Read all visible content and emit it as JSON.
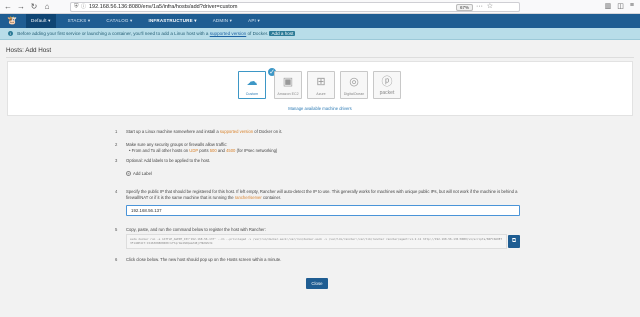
{
  "browser": {
    "url": "192.168.56.136:8080/env/1a5/infra/hosts/add?driver=custom",
    "zoom": "67%",
    "back_glyph": "←",
    "forward_glyph": "→",
    "reload_glyph": "↻",
    "home_glyph": "⌂",
    "shield_glyph": "⛨",
    "lock_glyph": "ⓘ",
    "dots_glyph": "···",
    "star_glyph": "☆",
    "library_glyph": "▥",
    "sidebar_glyph": "◫",
    "menu_glyph": "≡"
  },
  "header": {
    "logo_glyph": "🐮",
    "env_label": "Default ▾",
    "menu": [
      "STACKS ▾",
      "CATALOG ▾",
      "INFRASTRUCTURE ▾",
      "ADMIN ▾",
      "API ▾"
    ],
    "active_index": 2
  },
  "notice": {
    "info_glyph": "i",
    "text_before": "Before adding your first service or launching a container, you'll need to add a Linux host with a",
    "link_text": "supported version",
    "text_after": "of Docker.",
    "hide_label": "Add a host"
  },
  "page": {
    "title": "Hosts: Add Host"
  },
  "drivers": {
    "items": [
      {
        "label": "Custom",
        "glyph": "☁",
        "selected": true
      },
      {
        "label": "Amazon EC2",
        "glyph": "▣",
        "selected": false
      },
      {
        "label": "Azure",
        "glyph": "⊞",
        "selected": false
      },
      {
        "label": "DigitalOcean",
        "glyph": "◎",
        "selected": false
      },
      {
        "label": "packet",
        "glyph": "ⓟ",
        "selected": false
      }
    ],
    "check_glyph": "✓",
    "manage_link": "Manage available machine drivers"
  },
  "steps": {
    "s1_num": "1",
    "s1_a": "Start up a Linux machine somewhere and install a",
    "s1_link": "supported version",
    "s1_b": "of Docker on it.",
    "s2_num": "2",
    "s2_line1": "Make sure any security groups or firewalls allow traffic:",
    "s2_line2_a": "• From and To all other hosts on",
    "s2_udp1": "UDP",
    "s2_line2_b": "ports",
    "s2_p1": "500",
    "s2_line2_c": "and",
    "s2_p2": "4500",
    "s2_line2_d": "(for IPsec networking)",
    "s3_num": "3",
    "s3_text": "Optional: Add labels to be applied to the host.",
    "add_label_glyph": "+",
    "add_label": "Add Label",
    "s4_num": "4",
    "s4_a": "Specify the public IP that should be registered for this host. If left empty, Rancher will auto-detect the IP to use. This generally works for machines with unique public IPs, but will not work if the machine is behind a firewall/NAT or if it is the same machine that is running the",
    "s4_link": "rancher/server",
    "s4_b": "container.",
    "ip_value": "192.168.56.137",
    "s5_num": "5",
    "s5_text": "Copy, paste, and run the command below to register the host with Rancher:",
    "command": "sudo docker run -e CATTLE_AGENT_IP=\"192.168.56.137\" --rm --privileged -v /var/run/docker.sock:/var/run/docker.sock -v /var/lib/rancher:/var/lib/rancher rancher/agent:v1.2.11 http://192.168.56.136:8080/v1/scripts/B4FC0A0E73F14DE4C7:1546300800000:kFtqrbG4hKQaGZd8j7Hb8Vb3k",
    "copy_glyph": "⧉",
    "s6_num": "6",
    "s6_text": "Click close below. The new host should pop up on the Hosts screen within a minute."
  },
  "footer": {
    "close_label": "Close"
  },
  "colors": {
    "brand": "#1f5d92",
    "accent": "#d9822b",
    "notice_bg": "#b8dde9"
  }
}
